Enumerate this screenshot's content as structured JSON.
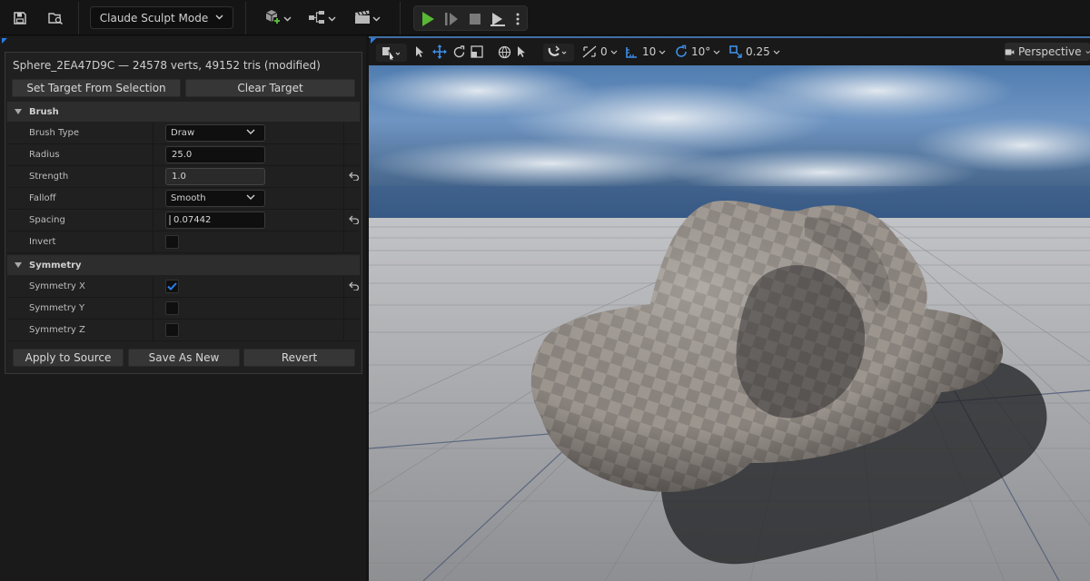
{
  "toolbar": {
    "mode_label": "Claude Sculpt Mode",
    "icons": [
      "save-icon",
      "browse-icon",
      "add-actor-icon",
      "blueprint-icon",
      "cinematics-icon",
      "play-icon",
      "step-icon",
      "stop-icon",
      "eject-icon",
      "more-icon"
    ],
    "play_color": "#58b833"
  },
  "panel": {
    "title": "Sphere_2EA47D9C — 24578 verts, 49152 tris (modified)",
    "set_target_label": "Set Target From Selection",
    "clear_target_label": "Clear Target",
    "brush_section": "Brush",
    "brush_type_label": "Brush Type",
    "brush_type_value": "Draw",
    "radius_label": "Radius",
    "radius_value": "25.0",
    "strength_label": "Strength",
    "strength_value": "1.0",
    "falloff_label": "Falloff",
    "falloff_value": "Smooth",
    "spacing_label": "Spacing",
    "spacing_value": "0.07442",
    "invert_label": "Invert",
    "invert_checked": false,
    "symmetry_section": "Symmetry",
    "sym_x_label": "Symmetry X",
    "sym_x_checked": true,
    "sym_y_label": "Symmetry Y",
    "sym_y_checked": false,
    "sym_z_label": "Symmetry Z",
    "sym_z_checked": false,
    "apply_label": "Apply to Source",
    "save_new_label": "Save As New",
    "revert_label": "Revert",
    "accent_color": "#2b7de9"
  },
  "viewport": {
    "snap_translate": "0",
    "grid_size": "10",
    "rotation_snap": "10°",
    "scale_snap": "0.25",
    "view_mode": "Perspective"
  }
}
